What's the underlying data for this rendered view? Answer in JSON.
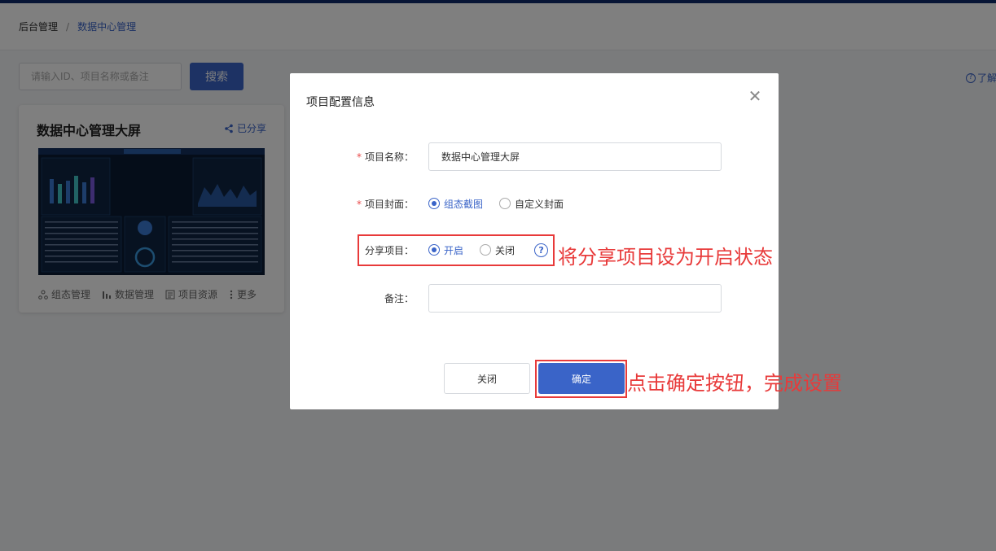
{
  "breadcrumb": {
    "root": "后台管理",
    "separator": "/",
    "current": "数据中心管理"
  },
  "search": {
    "placeholder": "请输入ID、项目名称或备注",
    "button_label": "搜索"
  },
  "help_link": {
    "icon_text": "?",
    "label": "了解"
  },
  "card": {
    "title": "数据中心管理大屏",
    "share_label": "已分享",
    "actions": [
      {
        "label": "组态管理",
        "icon": "topology-icon"
      },
      {
        "label": "数据管理",
        "icon": "bar-chart-icon"
      },
      {
        "label": "项目资源",
        "icon": "resource-icon"
      },
      {
        "label": "更多",
        "icon": "more-icon"
      }
    ]
  },
  "modal": {
    "title": "项目配置信息",
    "close_glyph": "✕",
    "required_mark": "*",
    "name_label": "项目名称：",
    "name_value": "数据中心管理大屏",
    "cover_label": "项目封面：",
    "cover_options": [
      "组态截图",
      "自定义封面"
    ],
    "cover_selected": "组态截图",
    "share_label": "分享项目：",
    "share_options": [
      "开启",
      "关闭"
    ],
    "share_selected": "开启",
    "share_help_text": "?",
    "remark_label": "备注：",
    "remark_value": "",
    "cancel_label": "关闭",
    "ok_label": "确定"
  },
  "annotations": {
    "share_note": "将分享项目设为开启状态",
    "confirm_note": "点击确定按钮，完成设置",
    "color": "#e83a3a"
  },
  "colors": {
    "primary": "#3a64c8",
    "required": "#e94b4b",
    "overlay": "rgba(0,0,0,0.5)"
  }
}
